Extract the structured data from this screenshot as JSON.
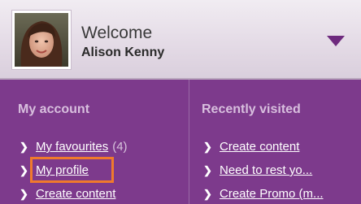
{
  "header": {
    "welcome": "Welcome",
    "user_name": "Alison Kenny",
    "toggle_icon": "chevron-down-icon"
  },
  "account": {
    "title": "My account",
    "links": [
      {
        "label": "My favourites",
        "count": "(4)"
      },
      {
        "label": "My profile",
        "highlighted": true
      },
      {
        "label": "Create content"
      }
    ]
  },
  "recent": {
    "title": "Recently visited",
    "links": [
      {
        "label": "Create content"
      },
      {
        "label": "Need to rest yo..."
      },
      {
        "label": "Create Promo (m..."
      }
    ]
  },
  "colors": {
    "header_bg": "#e4dbe6",
    "panel_purple": "#7d3a8c",
    "section_title": "#d8bfde",
    "link_text": "#ffffff",
    "toggle_arrow": "#6e2a7e",
    "highlight": "#f07a2c"
  }
}
